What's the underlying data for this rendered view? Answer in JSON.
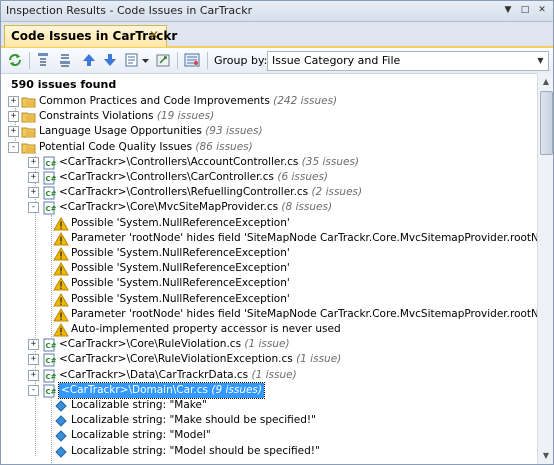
{
  "window": {
    "title": "Inspection Results - Code Issues in CarTrackr",
    "buttons": [
      "▼",
      "□",
      "✕"
    ]
  },
  "tab": {
    "label": "Code Issues in CarTrackr",
    "close": "✕"
  },
  "toolbar": {
    "icons": [
      "refresh-icon",
      "collapse-all-icon",
      "expand-all-icon",
      "previous-issue-icon",
      "next-issue-icon",
      "export-icon",
      "dropdown-icon",
      "settings-icon",
      "filter-icon"
    ],
    "group_by_label": "Group by:",
    "group_by_value": "Issue Category and File"
  },
  "summary": "590 issues found",
  "tree": [
    {
      "level": 0,
      "icon": "folder",
      "expander": "+",
      "label": "Common Practices and Code Improvements",
      "count": "(242 issues)"
    },
    {
      "level": 0,
      "icon": "folder",
      "expander": "+",
      "label": "Constraints Violations",
      "count": "(19 issues)"
    },
    {
      "level": 0,
      "icon": "folder",
      "expander": "+",
      "label": "Language Usage Opportunities",
      "count": "(93 issues)"
    },
    {
      "level": 0,
      "icon": "folder",
      "expander": "-",
      "label": "Potential Code Quality Issues",
      "count": "(86 issues)"
    },
    {
      "level": 1,
      "icon": "csfile",
      "expander": "+",
      "label": "<CarTrackr>\\Controllers\\AccountController.cs",
      "count": "(35 issues)"
    },
    {
      "level": 1,
      "icon": "csfile",
      "expander": "+",
      "label": "<CarTrackr>\\Controllers\\CarController.cs",
      "count": "(6 issues)"
    },
    {
      "level": 1,
      "icon": "csfile",
      "expander": "+",
      "label": "<CarTrackr>\\Controllers\\RefuellingController.cs",
      "count": "(2 issues)"
    },
    {
      "level": 1,
      "icon": "csfile",
      "expander": "-",
      "label": "<CarTrackr>\\Core\\MvcSiteMapProvider.cs",
      "count": "(8 issues)"
    },
    {
      "level": 2,
      "icon": "warning",
      "expander": "",
      "label": "Possible 'System.NullReferenceException'",
      "count": ""
    },
    {
      "level": 2,
      "icon": "warning",
      "expander": "",
      "label": "Parameter 'rootNode' hides field 'SiteMapNode CarTrackr.Core.MvcSitemapProvider.rootNode'",
      "count": ""
    },
    {
      "level": 2,
      "icon": "warning",
      "expander": "",
      "label": "Possible 'System.NullReferenceException'",
      "count": ""
    },
    {
      "level": 2,
      "icon": "warning",
      "expander": "",
      "label": "Possible 'System.NullReferenceException'",
      "count": ""
    },
    {
      "level": 2,
      "icon": "warning",
      "expander": "",
      "label": "Possible 'System.NullReferenceException'",
      "count": ""
    },
    {
      "level": 2,
      "icon": "warning",
      "expander": "",
      "label": "Possible 'System.NullReferenceException'",
      "count": ""
    },
    {
      "level": 2,
      "icon": "warning",
      "expander": "",
      "label": "Parameter 'rootNode' hides field 'SiteMapNode CarTrackr.Core.MvcSitemapProvider.rootNode'",
      "count": ""
    },
    {
      "level": 2,
      "icon": "warning",
      "expander": "",
      "label": "Auto-implemented property accessor is never used",
      "count": ""
    },
    {
      "level": 1,
      "icon": "csfile",
      "expander": "+",
      "label": "<CarTrackr>\\Core\\RuleViolation.cs",
      "count": "(1 issue)"
    },
    {
      "level": 1,
      "icon": "csfile",
      "expander": "+",
      "label": "<CarTrackr>\\Core\\RuleViolationException.cs",
      "count": "(1 issue)"
    },
    {
      "level": 1,
      "icon": "csfile",
      "expander": "+",
      "label": "<CarTrackr>\\Data\\CarTrackrData.cs",
      "count": "(1 issue)"
    },
    {
      "level": 1,
      "icon": "csfile",
      "expander": "-",
      "label": "<CarTrackr>\\Domain\\Car.cs",
      "count": "(9 issues)",
      "selected": true
    },
    {
      "level": 2,
      "icon": "hint",
      "expander": "",
      "label": "Localizable string: \"Make\"",
      "count": ""
    },
    {
      "level": 2,
      "icon": "hint",
      "expander": "",
      "label": "Localizable string: \"Make should be specified!\"",
      "count": ""
    },
    {
      "level": 2,
      "icon": "hint",
      "expander": "",
      "label": "Localizable string: \"Model\"",
      "count": ""
    },
    {
      "level": 2,
      "icon": "hint",
      "expander": "",
      "label": "Localizable string: \"Model should be specified!\"",
      "count": ""
    }
  ],
  "colors": {
    "selection": "#3399ff",
    "tab_accent": "#f5cf58",
    "count_text": "#6e6e6e",
    "warning": "#f2b705",
    "hint": "#3a8fd6"
  }
}
